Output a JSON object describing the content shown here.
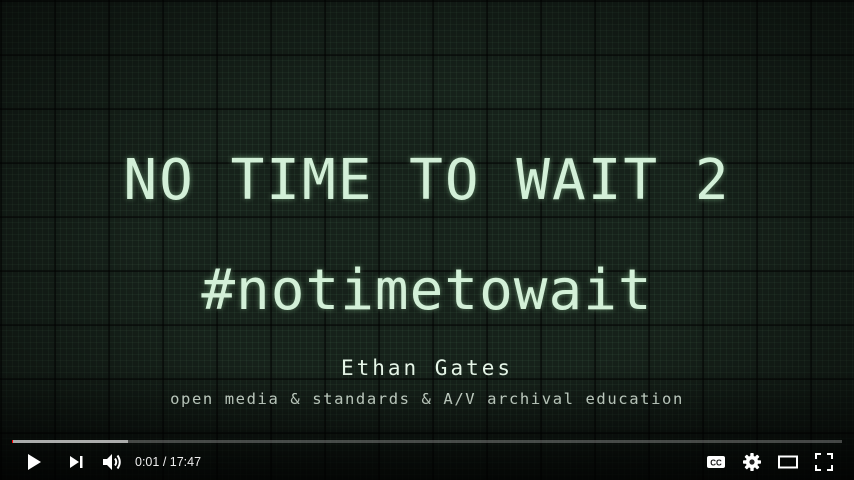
{
  "video": {
    "title_line1": "NO TIME TO WAIT 2",
    "title_line2": "#notimetowait",
    "presenter": "Ethan Gates",
    "subtitle": "open media & standards & A/V archival education"
  },
  "player": {
    "current_time": "0:01",
    "separator": " / ",
    "duration": "17:47",
    "progress_fraction": 0.0009,
    "buffered_fraction": 0.14,
    "icons": [
      "play-icon",
      "next-icon",
      "volume-icon",
      "captions-icon",
      "settings-icon",
      "theater-icon",
      "fullscreen-icon"
    ],
    "colors": {
      "background": "#16211a",
      "title_text": "#d3f0d8",
      "control_icon": "#ffffff"
    }
  }
}
